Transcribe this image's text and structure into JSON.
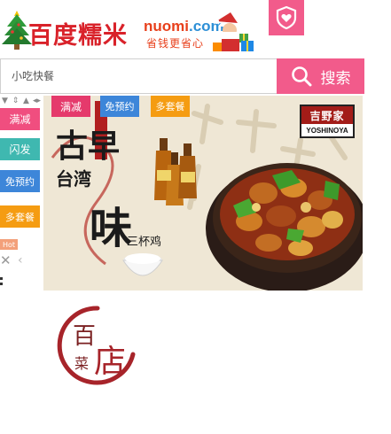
{
  "header": {
    "brand_cn": "百度糯米",
    "domain_main": "nuomi",
    "domain_tld": ".com",
    "slogan": "省钱更省心"
  },
  "search": {
    "placeholder": "小吃快餐",
    "button_label": "搜索"
  },
  "sidebar": {
    "tags": [
      "满减",
      "闪发",
      "免预约",
      "多套餐"
    ],
    "hot_label": "Hot"
  },
  "banner": {
    "tags": [
      "满减",
      "免预约",
      "多套餐"
    ],
    "brand_cn": "吉野家",
    "brand_en": "YOSHINOYA",
    "title_line1": "古早",
    "title_line2": "台湾",
    "title_big": "味",
    "dish_name": "三杯鸡"
  },
  "bottom_logo": {
    "text_main": "百",
    "text_side": "店",
    "text_small": "菜"
  },
  "colors": {
    "accent_pink": "#f25b8b",
    "tag_pink": "#f04e7f",
    "tag_teal": "#3fb8b0",
    "tag_blue": "#3d86d9",
    "tag_orange": "#f59c12",
    "brand_red": "#a31c18"
  },
  "icons": [
    "christmas-tree-icon",
    "santa-gift-icon",
    "heart-shield-icon",
    "search-icon",
    "close-icon",
    "chevron-left-icon"
  ]
}
